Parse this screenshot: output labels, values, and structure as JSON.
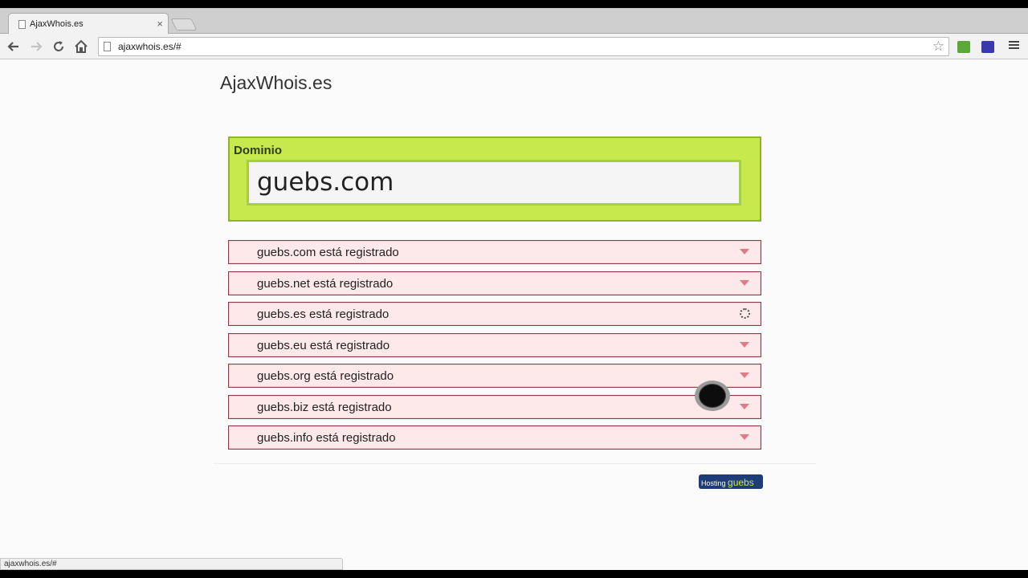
{
  "browser": {
    "tab_title": "AjaxWhois.es",
    "tab_close": "×",
    "url": "ajaxwhois.es/#",
    "status_url": "ajaxwhois.es/#"
  },
  "page": {
    "site_title": "AjaxWhois.es",
    "search": {
      "label": "Dominio",
      "value": "guebs.com"
    },
    "results": [
      {
        "label": "guebs.com está registrado",
        "state": "expand"
      },
      {
        "label": "guebs.net está registrado",
        "state": "expand"
      },
      {
        "label": "guebs.es está registrado",
        "state": "loading"
      },
      {
        "label": "guebs.eu está registrado",
        "state": "expand"
      },
      {
        "label": "guebs.org está registrado",
        "state": "expand"
      },
      {
        "label": "guebs.biz está registrado",
        "state": "expand"
      },
      {
        "label": "guebs.info está registrado",
        "state": "expand"
      }
    ],
    "hosting_badge": {
      "prefix": "Hosting",
      "brand": "guebs"
    }
  },
  "colors": {
    "search_bg": "#c8e94e",
    "result_bg": "#fde8ea",
    "result_border": "#8a3b46",
    "badge_bg": "#1e3c78"
  }
}
